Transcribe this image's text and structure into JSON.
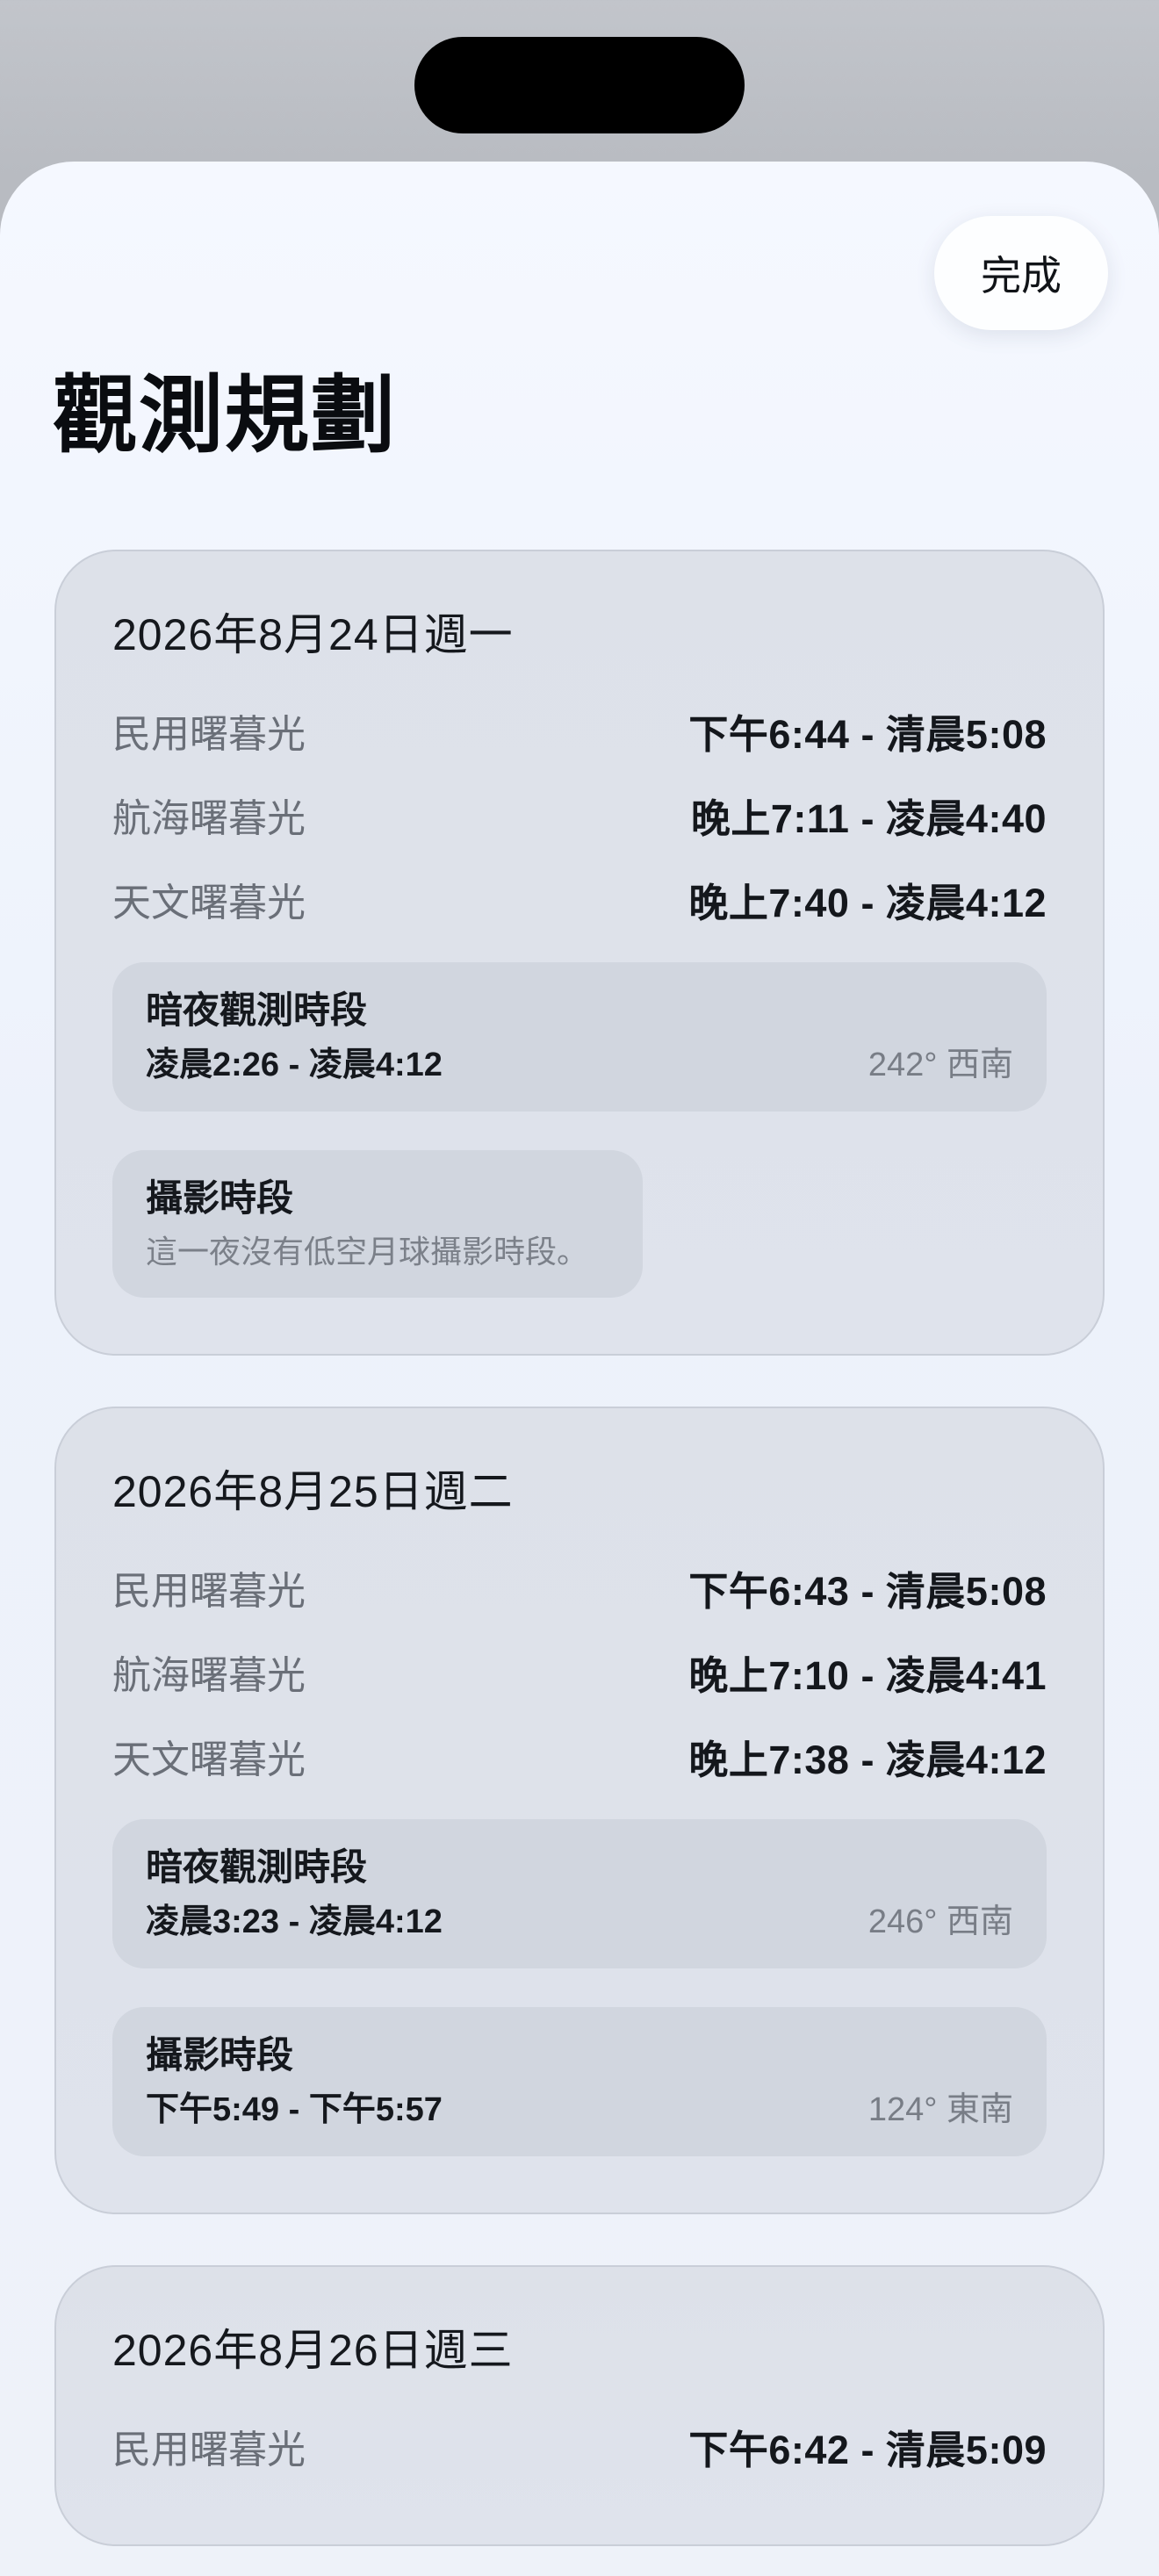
{
  "header": {
    "done_label": "完成",
    "title": "觀測規劃"
  },
  "days": [
    {
      "date": "2026年8月24日週一",
      "twilight": [
        {
          "label": "民用曙暮光",
          "time": "下午6:44 - 清晨5:08"
        },
        {
          "label": "航海曙暮光",
          "time": "晚上7:11 - 凌晨4:40"
        },
        {
          "label": "天文曙暮光",
          "time": "晚上7:40 - 凌晨4:12"
        }
      ],
      "dark_window": {
        "title": "暗夜觀測時段",
        "time": "凌晨2:26 - 凌晨4:12",
        "direction": "242° 西南"
      },
      "photo_window": {
        "title": "攝影時段",
        "note": "這一夜沒有低空月球攝影時段。"
      }
    },
    {
      "date": "2026年8月25日週二",
      "twilight": [
        {
          "label": "民用曙暮光",
          "time": "下午6:43 - 清晨5:08"
        },
        {
          "label": "航海曙暮光",
          "time": "晚上7:10 - 凌晨4:41"
        },
        {
          "label": "天文曙暮光",
          "time": "晚上7:38 - 凌晨4:12"
        }
      ],
      "dark_window": {
        "title": "暗夜觀測時段",
        "time": "凌晨3:23 - 凌晨4:12",
        "direction": "246° 西南"
      },
      "photo_window": {
        "title": "攝影時段",
        "time": "下午5:49 - 下午5:57",
        "direction": "124° 東南"
      }
    },
    {
      "date": "2026年8月26日週三",
      "twilight": [
        {
          "label": "民用曙暮光",
          "time": "下午6:42 - 清晨5:09"
        }
      ]
    }
  ]
}
